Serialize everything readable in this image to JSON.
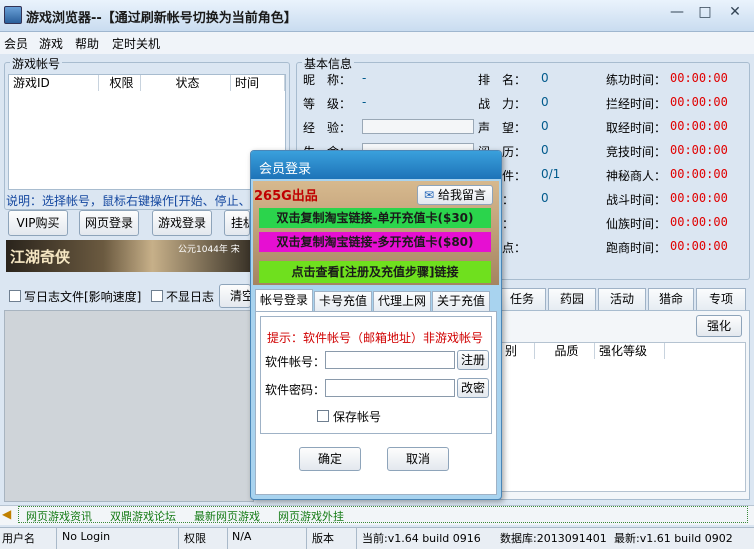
{
  "window": {
    "title": "游戏浏览器--【通过刷新帐号切换为当前角色】",
    "min": "—",
    "max": "□",
    "close": "✕"
  },
  "menu": [
    "会员",
    "游戏",
    "帮助",
    "定时关机"
  ],
  "accounts": {
    "legend": "游戏帐号",
    "columns": [
      "游戏ID",
      "权限",
      "状态",
      "时间"
    ],
    "hint": "说明：选择帐号，鼠标右键操作[开始、停止、",
    "buttons": [
      "VIP购买",
      "网页登录",
      "游戏登录",
      "挂机"
    ]
  },
  "banner": {
    "logo": "江湖奇侠",
    "year": "公元1044年 宋"
  },
  "options": {
    "log_file": "写日志文件[影响速度]",
    "hide_log": "不显日志",
    "clear": "清空"
  },
  "basic": {
    "legend": "基本信息",
    "col1": [
      {
        "label": "昵　称：",
        "value": "-"
      },
      {
        "label": "等　级：",
        "value": "-"
      },
      {
        "label": "经　验：",
        "value": ""
      },
      {
        "label": "生　命：",
        "value": ""
      }
    ],
    "col2": [
      {
        "label": "排　名：",
        "value": "0"
      },
      {
        "label": "战　力：",
        "value": "0"
      },
      {
        "label": "声　望：",
        "value": "0"
      },
      {
        "label": "阅　历：",
        "value": "0"
      },
      {
        "label": "物　件：",
        "value": "0/1"
      },
      {
        "label": "任务：",
        "value": "0"
      },
      {
        "label": "次数：",
        "value": ""
      },
      {
        "label": "积　点：",
        "value": ""
      }
    ],
    "col3": [
      {
        "label": "练功时间：",
        "value": "00:00:00"
      },
      {
        "label": "拦经时间：",
        "value": "00:00:00"
      },
      {
        "label": "取经时间：",
        "value": "00:00:00"
      },
      {
        "label": "竞技时间：",
        "value": "00:00:00"
      },
      {
        "label": "神秘商人：",
        "value": "00:00:00"
      },
      {
        "label": "战斗时间：",
        "value": "00:00:00"
      },
      {
        "label": "仙族时间：",
        "value": "00:00:00"
      },
      {
        "label": "跑商时间：",
        "value": "00:00:00"
      }
    ]
  },
  "right_tabs": [
    "任务",
    "药园",
    "活动",
    "猎命",
    "专项"
  ],
  "enhance": {
    "button": "强化",
    "columns": [
      "别",
      "品质",
      "强化等级"
    ]
  },
  "dialog": {
    "title": "会员登录",
    "brand": "265G出品",
    "message_btn": "给我留言",
    "promo1": "双击复制淘宝链接-单开充值卡($30)",
    "promo2": "双击复制淘宝链接-多开充值卡($80)",
    "promo3": "点击查看[注册及充值步骤]链接",
    "tabs": [
      "帐号登录",
      "卡号充值",
      "代理上网",
      "关于充值"
    ],
    "tip": "提示：软件帐号（邮箱地址）非游戏帐号",
    "account_label": "软件帐号：",
    "password_label": "软件密码：",
    "register": "注册",
    "change": "改密",
    "save": "保存帐号",
    "ok": "确定",
    "cancel": "取消"
  },
  "links": [
    "网页游戏资讯",
    "双鼎游戏论坛",
    "最新网页游戏",
    "网页游戏外挂"
  ],
  "status": {
    "user_label": "用户名",
    "user": "No Login",
    "perm_label": "权限",
    "perm": "N/A",
    "version_label": "版本",
    "current": "当前:v1.64 build 0916",
    "db": "数据库:2013091401",
    "latest": "最新:v1.61 build 0902"
  }
}
